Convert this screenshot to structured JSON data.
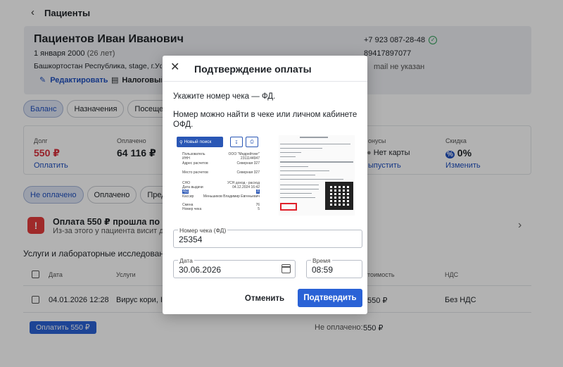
{
  "header": {
    "back_icon": "arrow-left-icon",
    "title": "Пациенты"
  },
  "patient": {
    "name": "Пациентов Иван Иванович",
    "dob": "1 января 2000",
    "age": "(26 лет)",
    "address": "Башкортостан Республика, stage, г.Уфа, ул.",
    "edit_label": "Редактировать",
    "tax_label": "Налоговый вычет",
    "phone1": "+7 923 087-28-48",
    "phone2": "89417897077",
    "email": "mail не указан"
  },
  "tabs": [
    "Баланс",
    "Назначения",
    "Посещения"
  ],
  "stats": {
    "debt_label": "Долг",
    "debt_value": "550 ₽",
    "debt_link": "Оплатить",
    "paid_label": "Оплачено",
    "paid_value": "64 116 ₽",
    "bonus_label": "онусы",
    "bonus_value": "Нет карты",
    "bonus_link": "ыпустить",
    "discount_label": "Скидка",
    "discount_value": "0%",
    "discount_link": "Изменить"
  },
  "filter_tabs": [
    "Не оплачено",
    "Оплачено",
    "Предоплата"
  ],
  "alert": {
    "title": "Оплата 550 ₽ прошла по кассе",
    "subtitle": "Из-за этого у пациента висит долг"
  },
  "section_title": "Услуги и лабораторные исследования",
  "table": {
    "columns": [
      "Дата",
      "Услуги",
      "тоимость",
      "НДС"
    ],
    "rows": [
      {
        "date": "04.01.2026 12:28",
        "service": "Вирус кори, IgG",
        "price": "550 ₽",
        "vat": "Без НДС"
      }
    ]
  },
  "footer": {
    "pay_button": "Оплатить 550 ₽",
    "unpaid_label": "Не оплачено:",
    "unpaid_value": "550 ₽"
  },
  "modal": {
    "title": "Подтверждение оплаты",
    "instruction": "Укажите номер чека — ФД.",
    "hint": "Номер можно найти в чеке или личном кабинете ОФД.",
    "receipt_left": {
      "search_button": "Новый поиск",
      "rows": [
        [
          "Пользователь",
          "ООО \"Медрейтинг\""
        ],
        [
          "ИНН",
          "2311144947"
        ],
        [
          "Адрес расчетов",
          "Северная 327"
        ],
        [
          "Место расчетов",
          "Северная 327"
        ],
        [
          "СНО",
          "УСН доход - расход"
        ],
        [
          "Дата выдачи",
          "04.12.2024 16:42"
        ],
        [
          "ФД",
          "8"
        ],
        [
          "Кассир",
          "Меньшиков Владимир Евгеньевич"
        ],
        [
          "Смена",
          "76"
        ],
        [
          "Номер чека",
          "5"
        ]
      ]
    },
    "receipt_field": {
      "label": "Номер чека (ФД)",
      "value": "25354"
    },
    "date_field": {
      "label": "Дата",
      "value": "30.06.2026"
    },
    "time_field": {
      "label": "Время",
      "value": "08:59"
    },
    "cancel_label": "Отменить",
    "confirm_label": "Подтвердить"
  },
  "colors": {
    "accent": "#2a62d6",
    "danger": "#d9303b",
    "success": "#2e9e57"
  }
}
